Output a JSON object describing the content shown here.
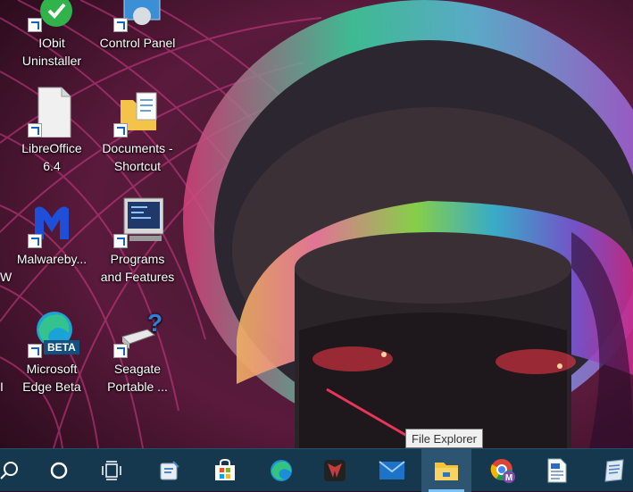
{
  "desktop": {
    "icons": [
      {
        "label": "IObit\nUninstaller",
        "icon": "iobit-uninstaller-icon"
      },
      {
        "label": "Control Panel",
        "icon": "control-panel-icon"
      },
      {
        "label": "LibreOffice\n6.4",
        "icon": "libreoffice-icon"
      },
      {
        "label": "Documents -\nShortcut",
        "icon": "documents-folder-icon"
      },
      {
        "label": "Malwareby...",
        "icon": "malwarebytes-icon"
      },
      {
        "label": "Programs\nand Features",
        "icon": "programs-features-icon"
      },
      {
        "label": "Microsoft\nEdge Beta",
        "icon": "edge-beta-icon"
      },
      {
        "label": "Seagate\nPortable ...",
        "icon": "seagate-drive-icon"
      }
    ],
    "edge_glyphs": [
      "W",
      "I"
    ],
    "edge_beta_badge": "BETA"
  },
  "taskbar": {
    "items": [
      {
        "name": "search",
        "icon": "search-icon"
      },
      {
        "name": "cortana",
        "icon": "cortana-icon"
      },
      {
        "name": "task-view",
        "icon": "task-view-icon"
      },
      {
        "name": "app",
        "icon": "snip-app-icon"
      },
      {
        "name": "microsoft-store",
        "icon": "store-icon"
      },
      {
        "name": "edge",
        "icon": "edge-icon"
      },
      {
        "name": "game-app",
        "icon": "predator-icon"
      },
      {
        "name": "mail",
        "icon": "mail-icon"
      },
      {
        "name": "file-explorer",
        "icon": "folder-icon",
        "active": true
      },
      {
        "name": "chrome",
        "icon": "chrome-icon"
      },
      {
        "name": "wordpad",
        "icon": "wordpad-icon"
      },
      {
        "name": "notepad-app",
        "icon": "notepad-icon"
      }
    ],
    "tooltip": "File Explorer",
    "chrome_badge": "M"
  },
  "colors": {
    "taskbar_bg": "#16384f",
    "active_underline": "#7cc4f5",
    "arrow": "#e8365b"
  }
}
